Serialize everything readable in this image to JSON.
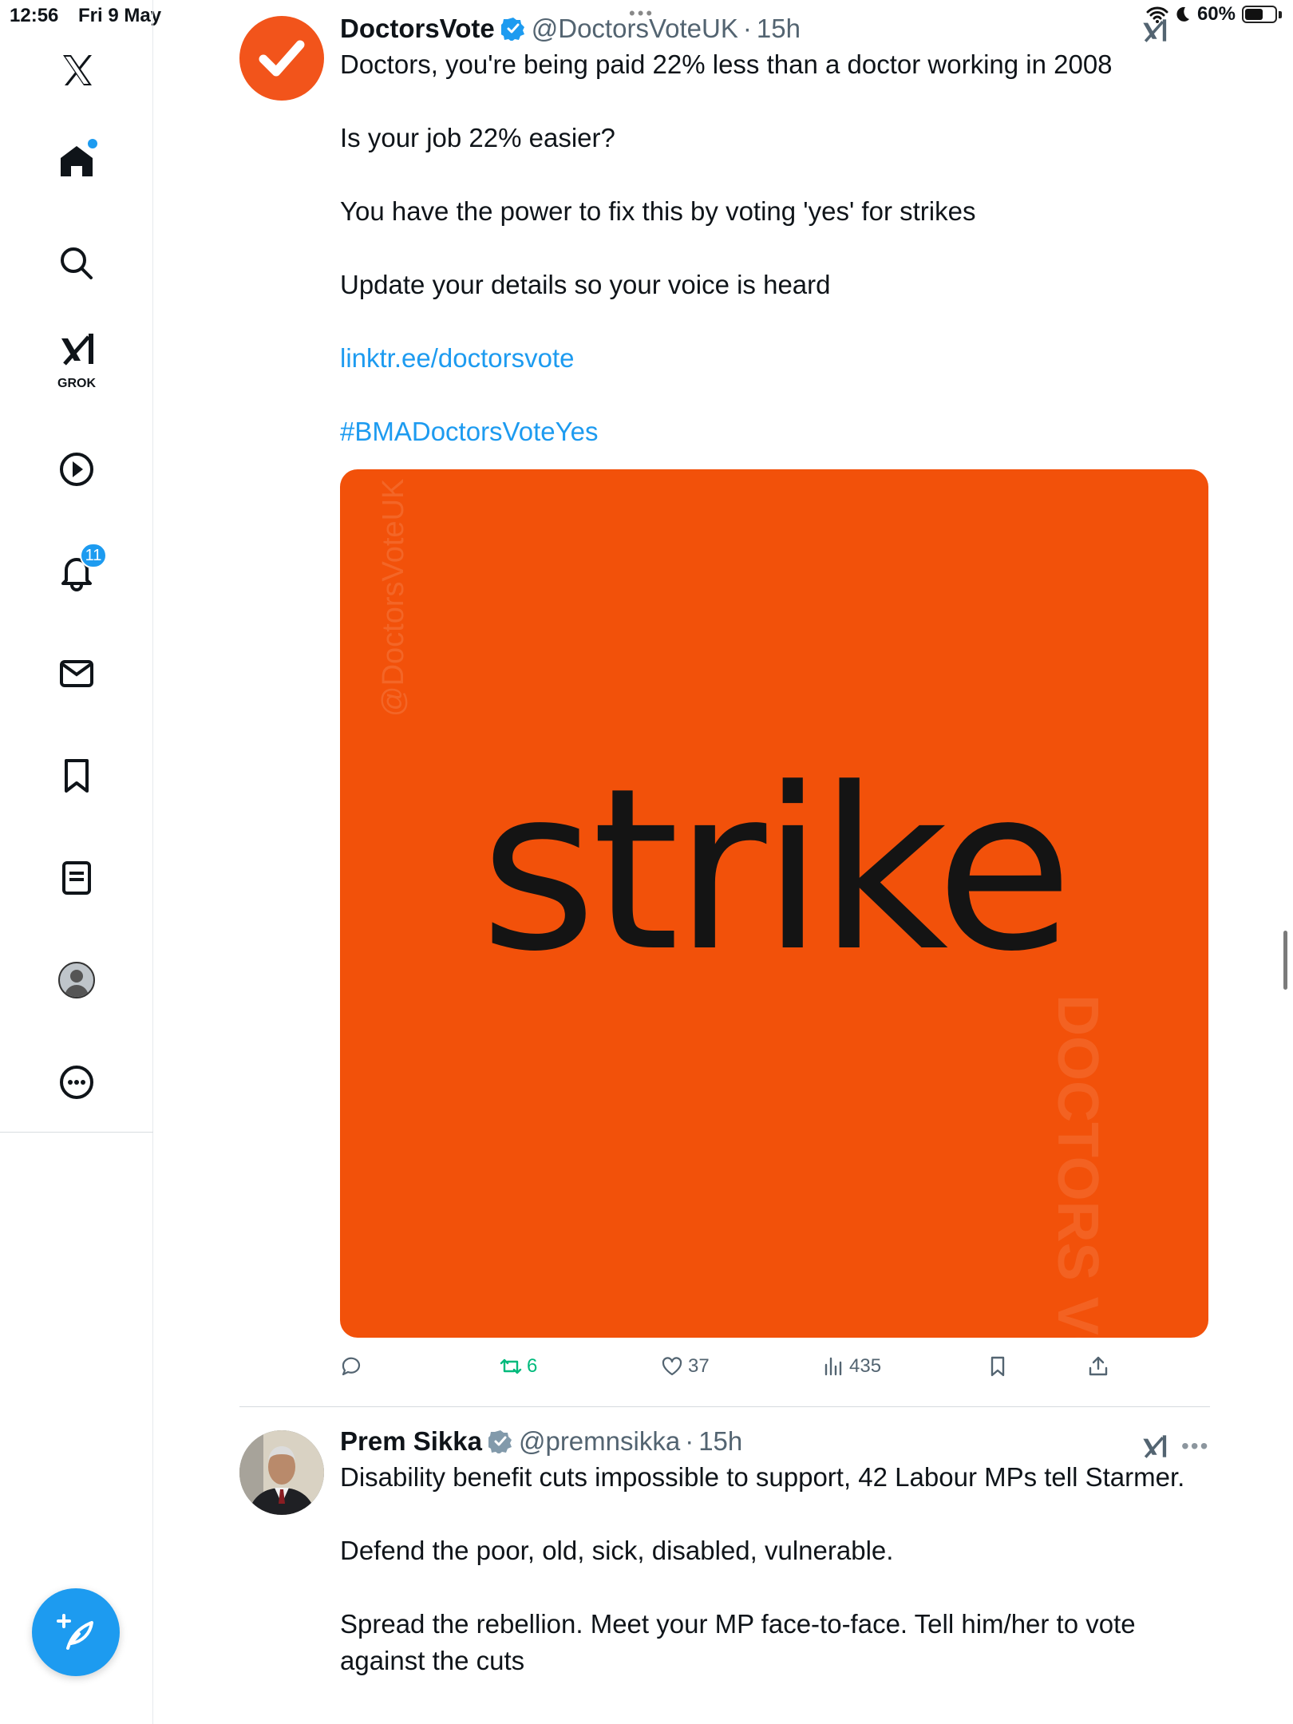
{
  "status_bar": {
    "time": "12:56",
    "date": "Fri 9 May",
    "battery": "60%",
    "battery_level": 0.6
  },
  "sidebar": {
    "items": [
      {
        "icon": "x-logo-icon"
      },
      {
        "icon": "home-icon",
        "has_dot": true
      },
      {
        "icon": "search-icon"
      },
      {
        "icon": "grok-icon",
        "label": "GROK"
      },
      {
        "icon": "play-icon"
      },
      {
        "icon": "bell-icon",
        "badge": "11"
      },
      {
        "icon": "mail-icon"
      },
      {
        "icon": "bookmark-icon"
      },
      {
        "icon": "list-icon"
      },
      {
        "icon": "avatar-icon"
      },
      {
        "icon": "more-icon"
      }
    ],
    "compose_icon": "feather-plus-icon"
  },
  "colors": {
    "accent": "#1d9bf0",
    "retweet": "#00ba7c",
    "media_bg": "#f2510a",
    "avatar_bg": "#f2541b"
  },
  "tweets": [
    {
      "name": "DoctorsVote",
      "handle": "@DoctorsVoteUK",
      "time": "15h",
      "paragraphs": [
        "Doctors, you're being paid 22% less than a doctor working in 2008",
        "Is your job 22% easier?",
        "You have the power to fix this by voting 'yes' for strikes",
        "Update your details so your voice is heard"
      ],
      "link": "linktr.ee/doctorsvote",
      "hashtag": "#BMADoctorsVoteYes",
      "media": {
        "word": "strike",
        "watermark_handle": "@DoctorsVoteUK",
        "watermark_logo": "DOCTORS VOTE"
      },
      "stats": {
        "replies": "",
        "retweets": "6",
        "likes": "37",
        "views": "435"
      }
    },
    {
      "name": "Prem Sikka",
      "handle": "@premnsikka",
      "time": "15h",
      "paragraphs": [
        "Disability benefit cuts impossible to support, 42 Labour MPs tell Starmer.",
        "Defend the poor, old, sick, disabled, vulnerable.",
        "Spread the rebellion. Meet your MP face-to-face. Tell him/her to vote against the cuts"
      ]
    }
  ]
}
